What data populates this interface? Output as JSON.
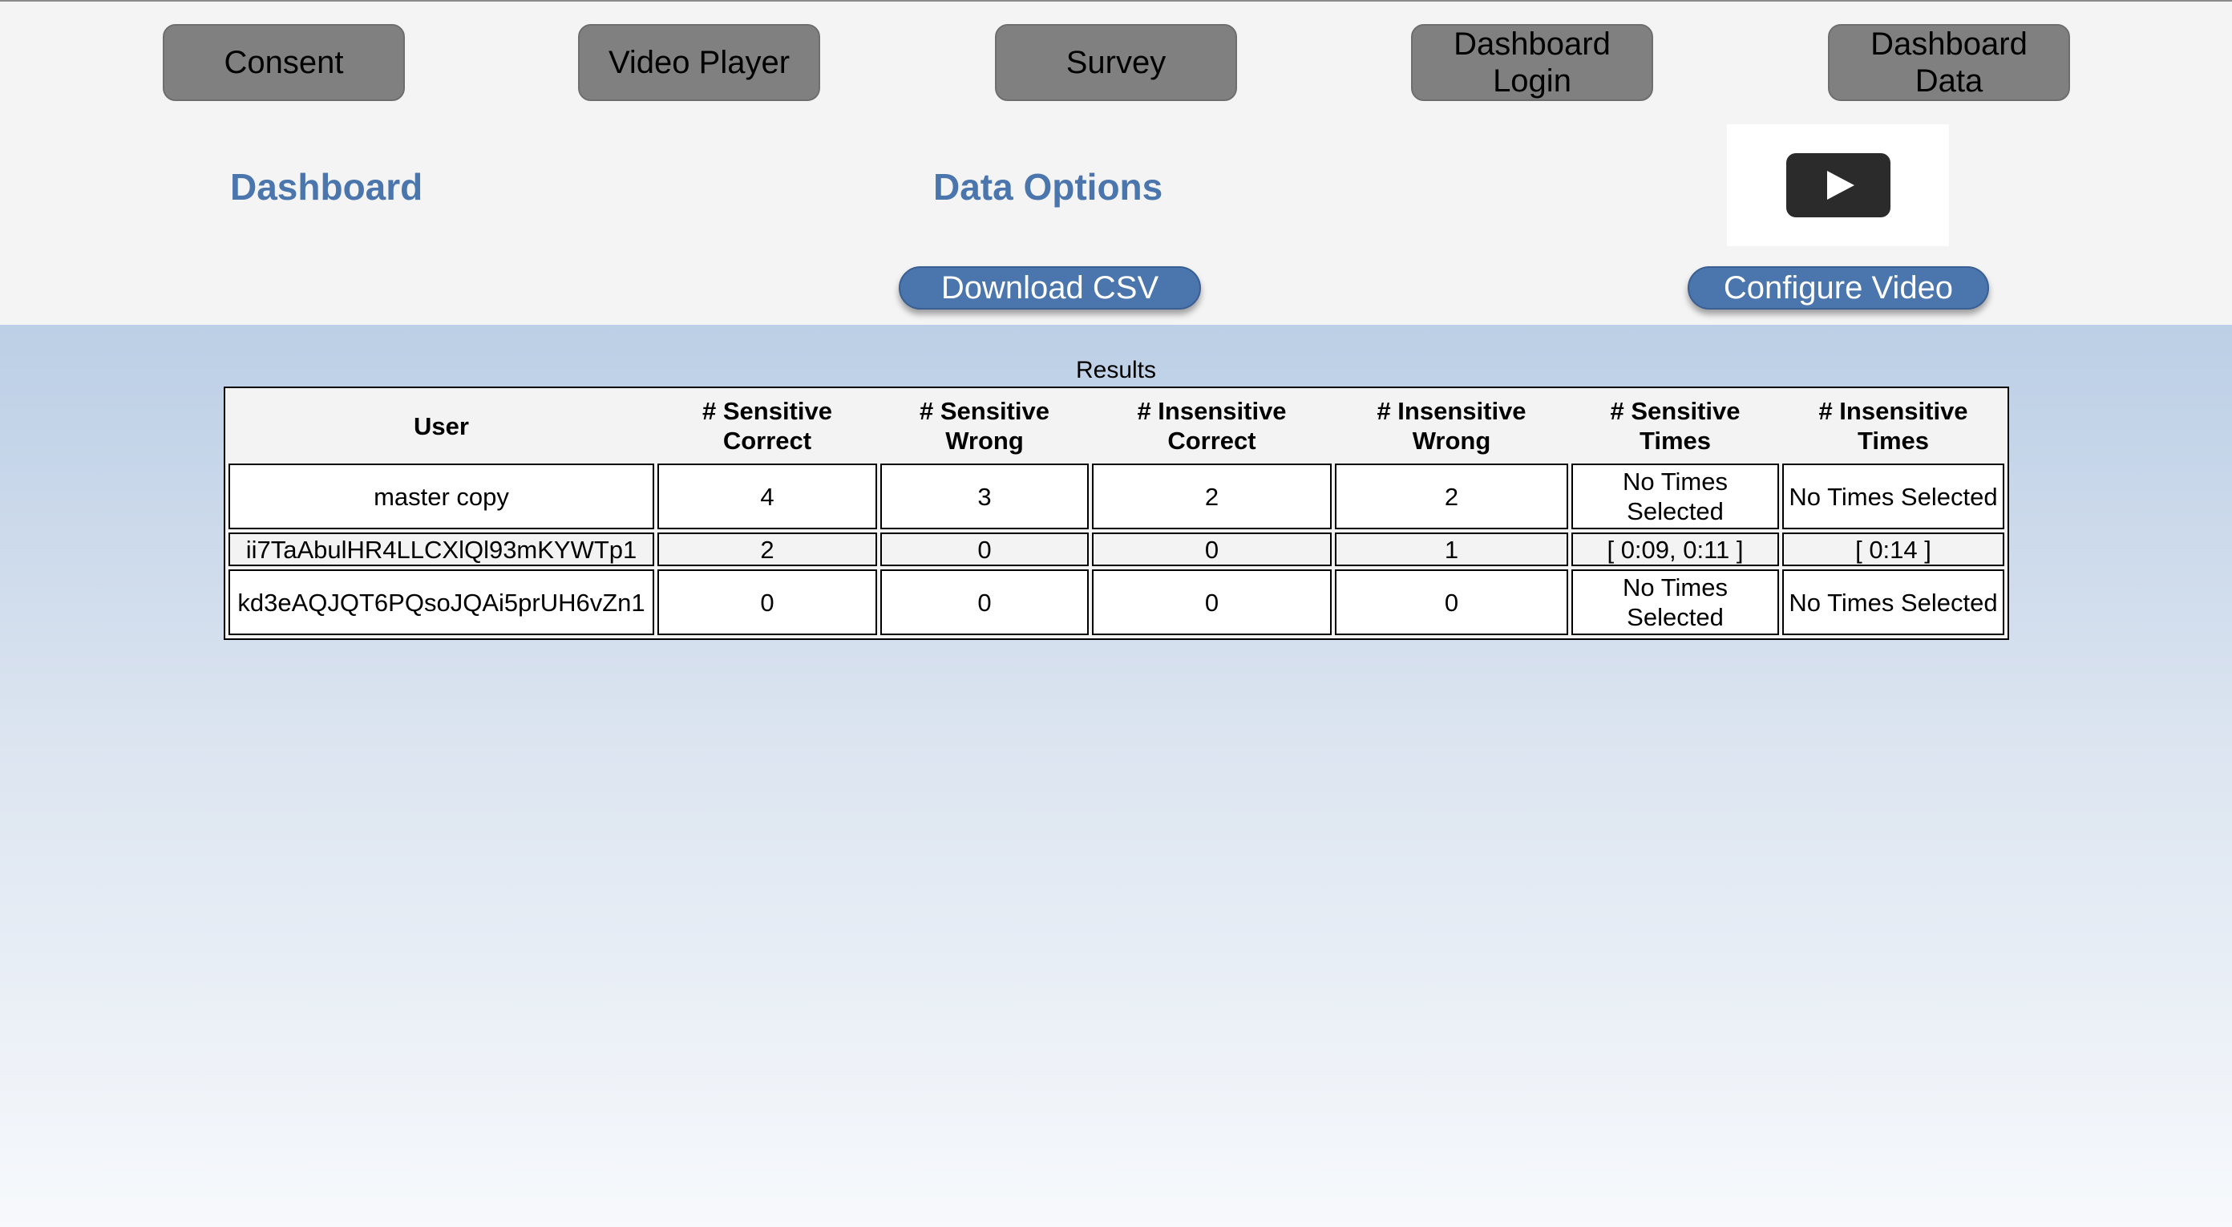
{
  "nav": {
    "items": [
      {
        "label": "Consent"
      },
      {
        "label": "Video Player"
      },
      {
        "label": "Survey"
      },
      {
        "label": "Dashboard Login"
      },
      {
        "label": "Dashboard Data"
      }
    ]
  },
  "header": {
    "dashboard_title": "Dashboard",
    "data_options_title": "Data Options",
    "download_csv_label": "Download CSV",
    "configure_video_label": "Configure Video",
    "play_icon": "play-icon"
  },
  "results": {
    "caption": "Results",
    "columns": [
      "User",
      "# Sensitive Correct",
      "# Sensitive Wrong",
      "# Insensitive Correct",
      "# Insensitive Wrong",
      "# Sensitive Times",
      "# Insensitive Times"
    ],
    "rows": [
      [
        "master copy",
        "4",
        "3",
        "2",
        "2",
        "No Times Selected",
        "No Times Selected"
      ],
      [
        "ii7TaAbulHR4LLCXlQl93mKYWTp1",
        "2",
        "0",
        "0",
        "1",
        "[ 0:09, 0:11 ]",
        "[ 0:14 ]"
      ],
      [
        "kd3eAQJQT6PQsoJQAi5prUH6vZn1",
        "0",
        "0",
        "0",
        "0",
        "No Times Selected",
        "No Times Selected"
      ]
    ]
  },
  "colors": {
    "accent": "#4a75ad",
    "nav_button": "#808080",
    "top_background": "#f4f4f4",
    "gradient_top": "#bccfe6",
    "gradient_bottom": "#f7f9fc"
  }
}
